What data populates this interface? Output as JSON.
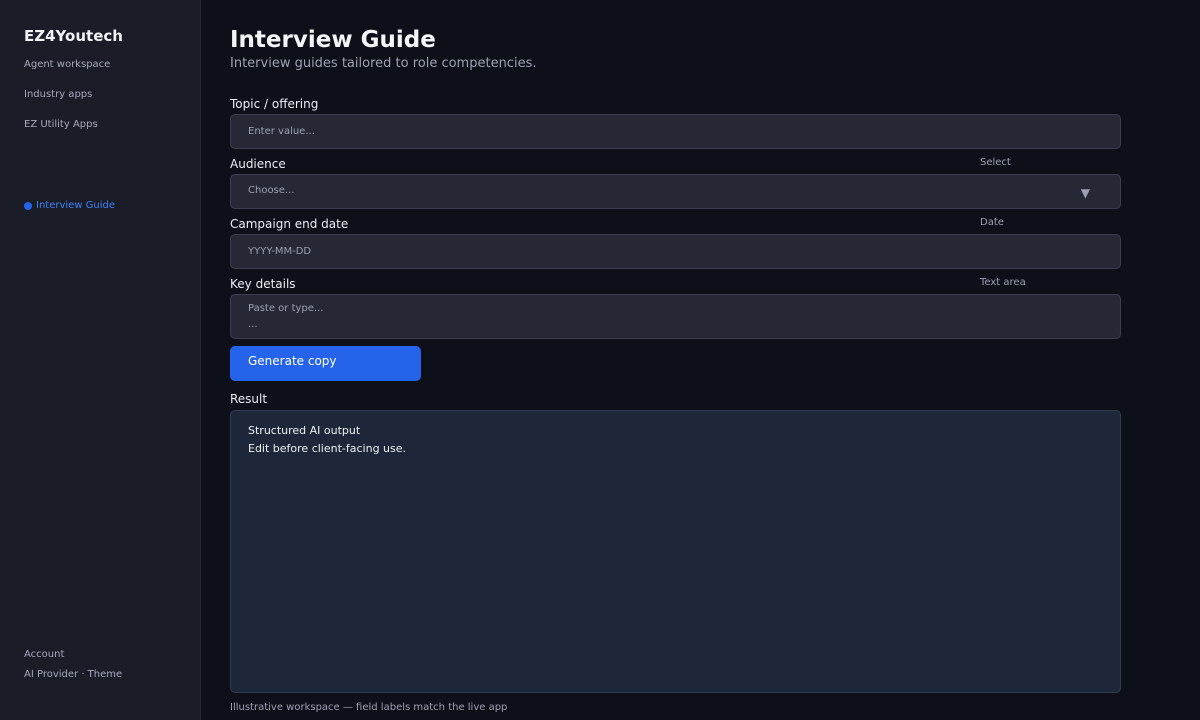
{
  "sidebar": {
    "brand": "EZ4Youtech",
    "nav": [
      {
        "label": "Agent workspace"
      },
      {
        "label": "Industry apps"
      },
      {
        "label": "EZ Utility Apps"
      }
    ],
    "active_item": "Interview Guide",
    "footer": {
      "account": "Account",
      "provider_theme": "AI Provider · Theme"
    }
  },
  "header": {
    "title": "Interview Guide",
    "subtitle": "Interview guides tailored to role competencies."
  },
  "form": {
    "topic": {
      "label": "Topic / offering",
      "placeholder": "Enter value..."
    },
    "audience": {
      "label": "Audience",
      "type": "Select",
      "value": "Choose..."
    },
    "end_date": {
      "label": "Campaign end date",
      "type": "Date",
      "placeholder": "YYYY-MM-DD"
    },
    "details": {
      "label": "Key details",
      "type": "Text area",
      "line1": "Paste or type...",
      "line2": "..."
    },
    "generate_label": "Generate copy"
  },
  "result": {
    "label": "Result",
    "line1": "Structured AI output",
    "line2": "Edit before client-facing use."
  },
  "footnote": "Illustrative workspace — field labels match the live app",
  "colors": {
    "accent": "#2563eb",
    "background": "#0e1019",
    "sidebar": "#1a1c27"
  }
}
